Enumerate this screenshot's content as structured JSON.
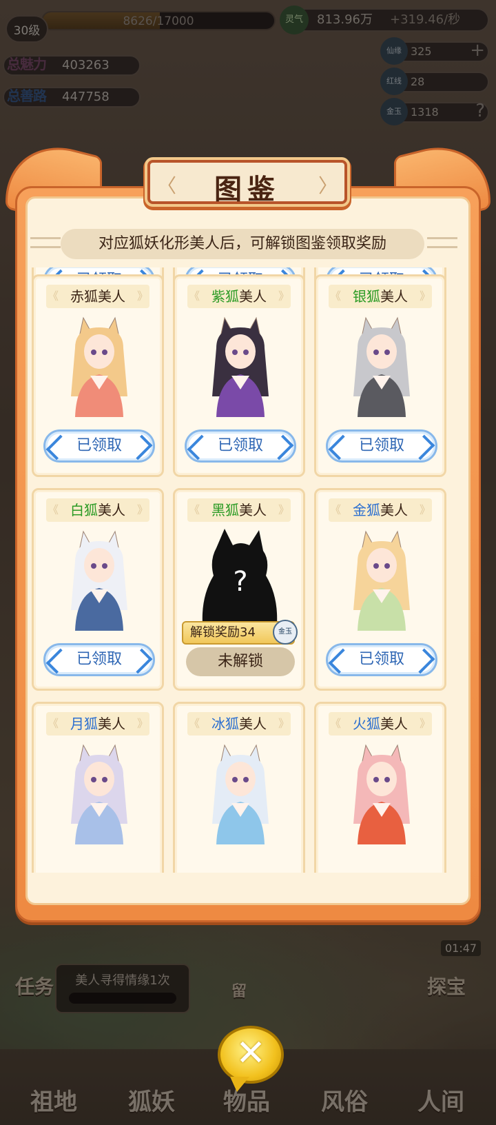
{
  "hud": {
    "level": "30级",
    "exp_text": "8626/17000",
    "exp_fraction": 0.507,
    "charm_label": "总魅力",
    "charm_value": "403263",
    "merit_label": "总善路",
    "merit_value": "447758",
    "spirit_label": "灵气",
    "spirit_value": "813.96万",
    "spirit_rate": "+319.46/秒",
    "res1_label": "仙缘",
    "res1_value": "325",
    "res1_action": "+",
    "res2_label": "红线",
    "res2_value": "28",
    "res3_label": "金玉",
    "res3_value": "1318",
    "res3_action": "?"
  },
  "modal": {
    "title": "图鉴",
    "subtitle": "对应狐妖化形美人后，可解锁图鉴领取奖励",
    "top_row_buttons": [
      "已领取",
      "已领取",
      "已领取"
    ],
    "cards": [
      {
        "prefix": "赤狐",
        "suffix": "美人",
        "prefix_color": "plain",
        "state": "claimed",
        "button": "已领取",
        "hair": "#f3c98a",
        "outfit": "#f08c78"
      },
      {
        "prefix": "紫狐",
        "suffix": "美人",
        "prefix_color": "green",
        "state": "claimed",
        "button": "已领取",
        "hair": "#3a3040",
        "outfit": "#7a4aa8"
      },
      {
        "prefix": "银狐",
        "suffix": "美人",
        "prefix_color": "green",
        "state": "claimed",
        "button": "已领取",
        "hair": "#c8c8cc",
        "outfit": "#5a5a60"
      },
      {
        "prefix": "白狐",
        "suffix": "美人",
        "prefix_color": "green",
        "state": "claimed",
        "button": "已领取",
        "hair": "#eef0f6",
        "outfit": "#4a6aa0"
      },
      {
        "prefix": "黑狐",
        "suffix": "美人",
        "prefix_color": "green",
        "state": "locked",
        "button": "未解锁",
        "reward": "解锁奖励34",
        "reward_icon": "金玉"
      },
      {
        "prefix": "金狐",
        "suffix": "美人",
        "prefix_color": "blue",
        "state": "claimed",
        "button": "已领取",
        "hair": "#f6d49a",
        "outfit": "#c8e0a8"
      },
      {
        "prefix": "月狐",
        "suffix": "美人",
        "prefix_color": "blue",
        "state": "claimed",
        "button": "",
        "hair": "#dcd6ec",
        "outfit": "#a8c0e8"
      },
      {
        "prefix": "冰狐",
        "suffix": "美人",
        "prefix_color": "blue",
        "state": "claimed",
        "button": "",
        "hair": "#e4ecf6",
        "outfit": "#8ec6ea"
      },
      {
        "prefix": "火狐",
        "suffix": "美人",
        "prefix_color": "blue",
        "state": "claimed",
        "button": "",
        "hair": "#f4b8b8",
        "outfit": "#e86040"
      }
    ],
    "close_label": "✕"
  },
  "background": {
    "quest_text": "美人寻得情缘1次",
    "timer": "01:47",
    "left_side": "任务",
    "right_side": "探宝",
    "stay_label": "留",
    "nav": [
      "祖地",
      "狐妖",
      "物品",
      "风俗",
      "人间"
    ]
  }
}
